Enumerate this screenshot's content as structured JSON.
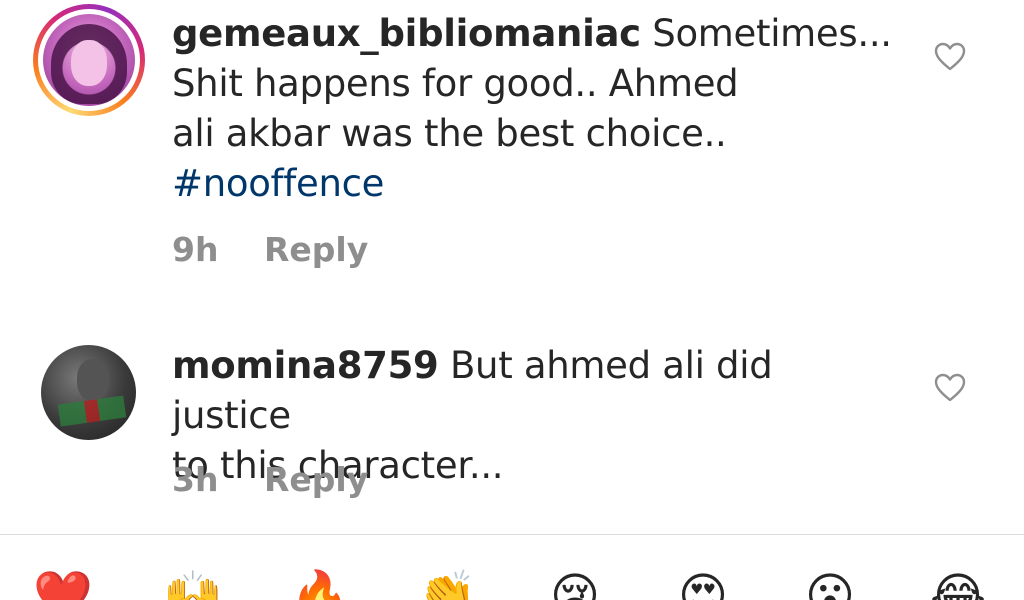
{
  "comments": [
    {
      "username": "gemeaux_bibliomaniac",
      "text_lines": [
        "Sometimes...",
        "Shit happens for good.. Ahmed",
        "ali akbar was the best choice.."
      ],
      "hashtag": "#nooffence",
      "time": "9h",
      "reply_label": "Reply"
    },
    {
      "username": "momina8759",
      "text_lines": [
        "But ahmed ali did justice",
        "to this character..."
      ],
      "time": "3h",
      "reply_label": "Reply"
    }
  ],
  "emoji_reactions": [
    "❤️",
    "🙌",
    "🔥",
    "👏",
    "😢",
    "😍",
    "😮",
    "😂"
  ],
  "colors": {
    "username": "#262626",
    "meta": "#8e8e8e",
    "hashtag": "#00376b",
    "divider": "#dbdbdb"
  }
}
